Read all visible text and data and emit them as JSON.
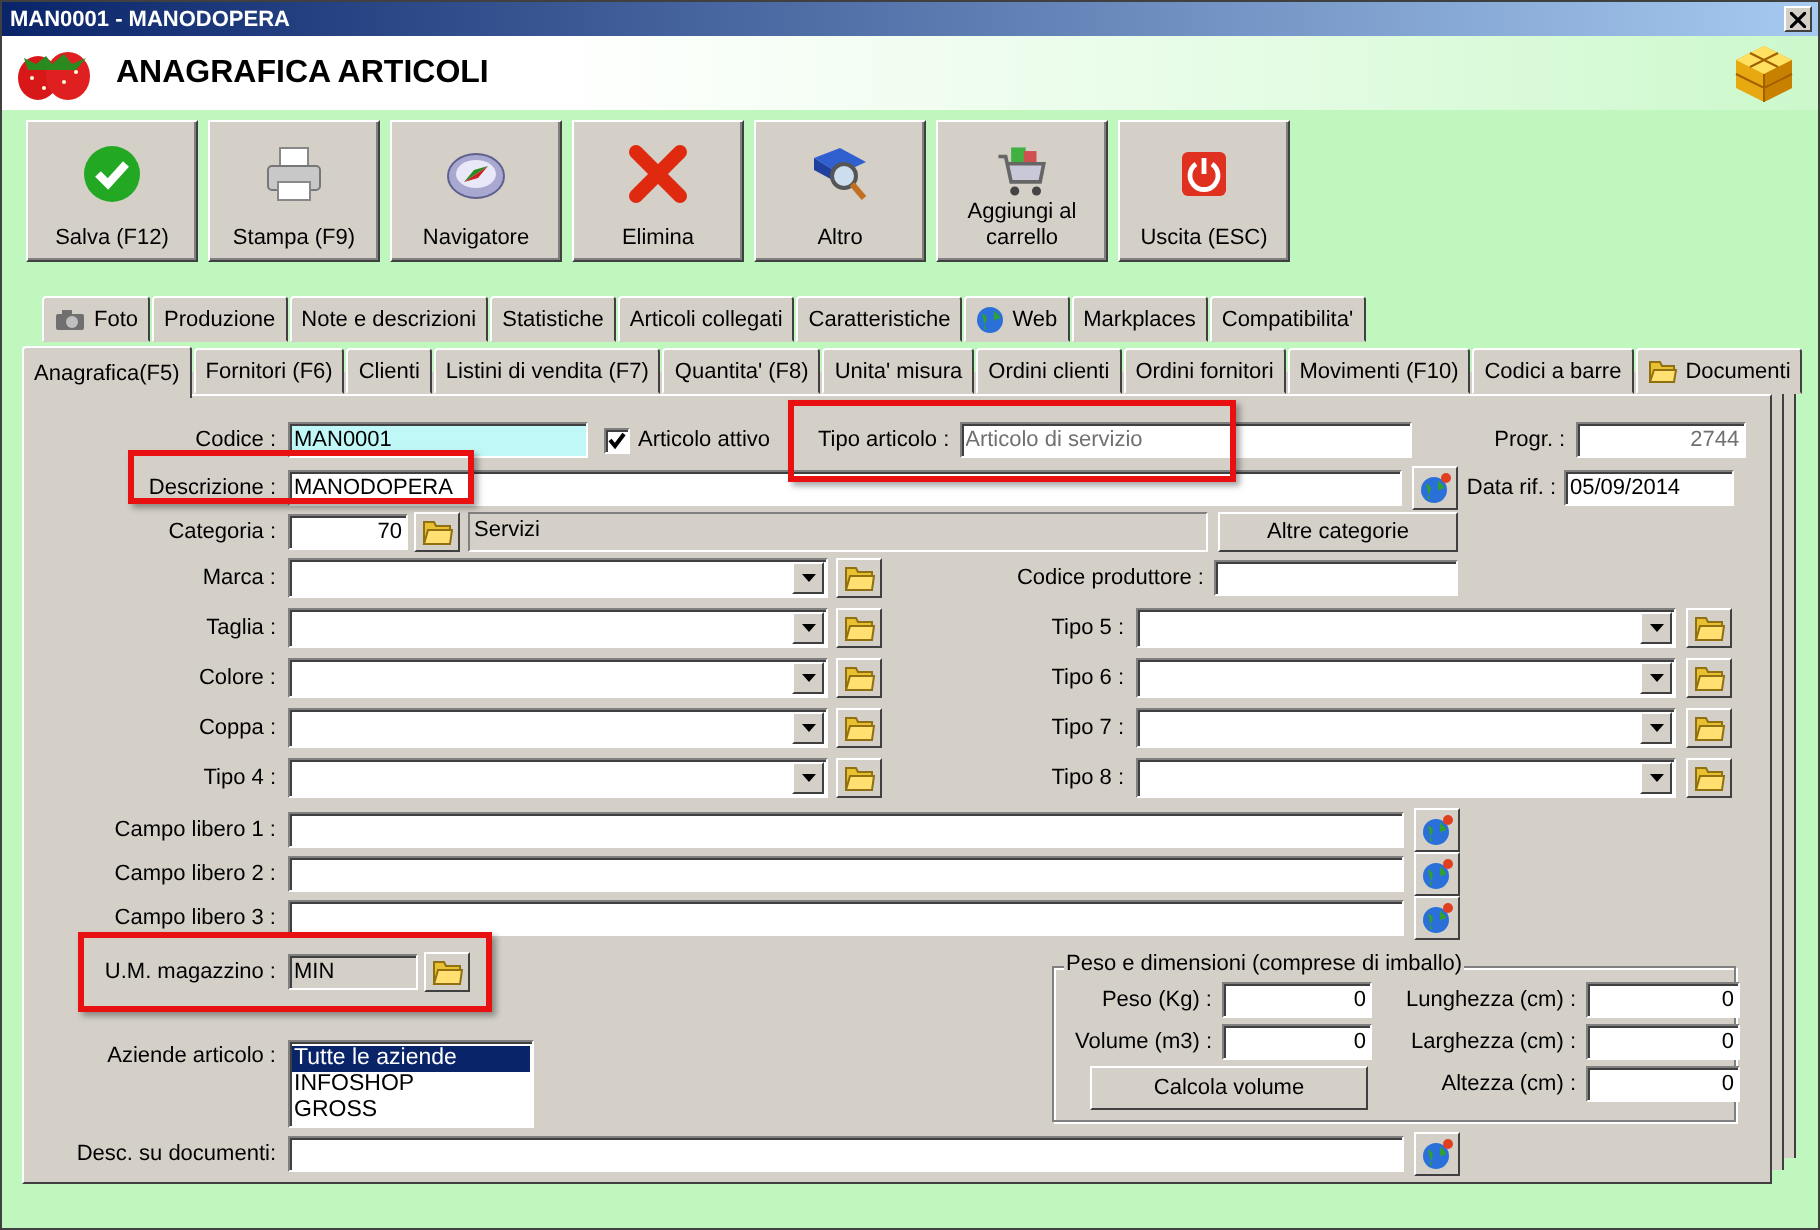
{
  "window": {
    "title": "MAN0001 - MANODOPERA"
  },
  "header": {
    "title": "ANAGRAFICA ARTICOLI"
  },
  "toolbar": [
    {
      "label": "Salva (F12)"
    },
    {
      "label": "Stampa (F9)"
    },
    {
      "label": "Navigatore"
    },
    {
      "label": "Elimina"
    },
    {
      "label": "Altro"
    },
    {
      "label": "Aggiungi al carrello"
    },
    {
      "label": "Uscita (ESC)"
    }
  ],
  "tabs_row1": [
    {
      "label": "Foto",
      "selected": false
    },
    {
      "label": "Produzione",
      "selected": false
    },
    {
      "label": "Note e descrizioni",
      "selected": false
    },
    {
      "label": "Statistiche",
      "selected": false
    },
    {
      "label": "Articoli collegati",
      "selected": false
    },
    {
      "label": "Caratteristiche",
      "selected": false
    },
    {
      "label": "Web",
      "selected": false
    },
    {
      "label": "Markplaces",
      "selected": false
    },
    {
      "label": "Compatibilita'",
      "selected": false
    }
  ],
  "tabs_row2": [
    {
      "label": "Anagrafica(F5)",
      "selected": true
    },
    {
      "label": "Fornitori (F6)",
      "selected": false
    },
    {
      "label": "Clienti",
      "selected": false
    },
    {
      "label": "Listini di vendita (F7)",
      "selected": false
    },
    {
      "label": "Quantita' (F8)",
      "selected": false
    },
    {
      "label": "Unita' misura",
      "selected": false
    },
    {
      "label": "Ordini clienti",
      "selected": false
    },
    {
      "label": "Ordini fornitori",
      "selected": false
    },
    {
      "label": "Movimenti (F10)",
      "selected": false
    },
    {
      "label": "Codici a barre",
      "selected": false
    },
    {
      "label": "Documenti",
      "selected": false
    }
  ],
  "form": {
    "codice": {
      "label": "Codice :",
      "value": "MAN0001",
      "focused": true
    },
    "attivo": {
      "label": "Articolo attivo",
      "checked": true
    },
    "tipo_articolo": {
      "label": "Tipo articolo :",
      "value": "Articolo di servizio",
      "disabled": true,
      "highlighted": true
    },
    "progr": {
      "label": "Progr. :",
      "value": "2744",
      "disabled": true
    },
    "descrizione": {
      "label": "Descrizione :",
      "value": "MANODOPERA",
      "highlighted": true
    },
    "data_rif": {
      "label": "Data rif. :",
      "value": "05/09/2014"
    },
    "categoria": {
      "label": "Categoria :",
      "code": "70",
      "name": "Servizi"
    },
    "altre_categorie": "Altre categorie",
    "codice_produttore": {
      "label": "Codice produttore :"
    },
    "combos_left": [
      {
        "label": "Marca :"
      },
      {
        "label": "Taglia :"
      },
      {
        "label": "Colore :"
      },
      {
        "label": "Coppa :"
      },
      {
        "label": "Tipo 4 :"
      }
    ],
    "combos_right": [
      {
        "label": "Tipo 5 :"
      },
      {
        "label": "Tipo 6 :"
      },
      {
        "label": "Tipo 7 :"
      },
      {
        "label": "Tipo 8 :"
      }
    ],
    "campi_liberi": [
      {
        "label": "Campo libero 1 :"
      },
      {
        "label": "Campo libero 2 :"
      },
      {
        "label": "Campo libero 3 :"
      }
    ],
    "um_magazzino": {
      "label": "U.M. magazzino :",
      "value": "MIN",
      "highlighted": true
    },
    "aziende": {
      "label": "Aziende articolo :",
      "items": [
        {
          "label": "Tutte le aziende",
          "selected": true
        },
        {
          "label": "INFOSHOP",
          "selected": false
        },
        {
          "label": "GROSS",
          "selected": false
        }
      ]
    },
    "peso_group": {
      "title": "Peso e dimensioni (comprese di imballo)",
      "fields": [
        {
          "label": "Peso (Kg) :",
          "value": "0"
        },
        {
          "label": "Volume (m3) :",
          "value": "0"
        }
      ],
      "button": "Calcola volume",
      "dims": [
        {
          "label": "Lunghezza (cm) :",
          "value": "0"
        },
        {
          "label": "Larghezza (cm) :",
          "value": "0"
        },
        {
          "label": "Altezza (cm) :",
          "value": "0"
        }
      ]
    },
    "desc_documenti": {
      "label": "Desc. su documenti:"
    }
  }
}
